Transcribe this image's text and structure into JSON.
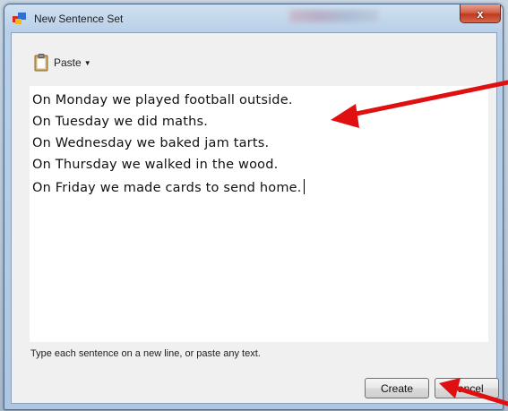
{
  "window": {
    "title": "New Sentence Set",
    "close_label": "x"
  },
  "toolbar": {
    "paste_label": "Paste"
  },
  "editor": {
    "lines": [
      "On Monday we played football outside.",
      "On Tuesday we did maths.",
      "On Wednesday we baked jam tarts.",
      "On Thursday we walked in the wood.",
      "On Friday we made cards to send home."
    ]
  },
  "hint": "Type each sentence on a new line, or paste any text.",
  "buttons": {
    "create_label": "Create",
    "cancel_label": "Cancel"
  },
  "colors": {
    "annotation_arrow": "#e01010",
    "close_button": "#c9432a"
  }
}
